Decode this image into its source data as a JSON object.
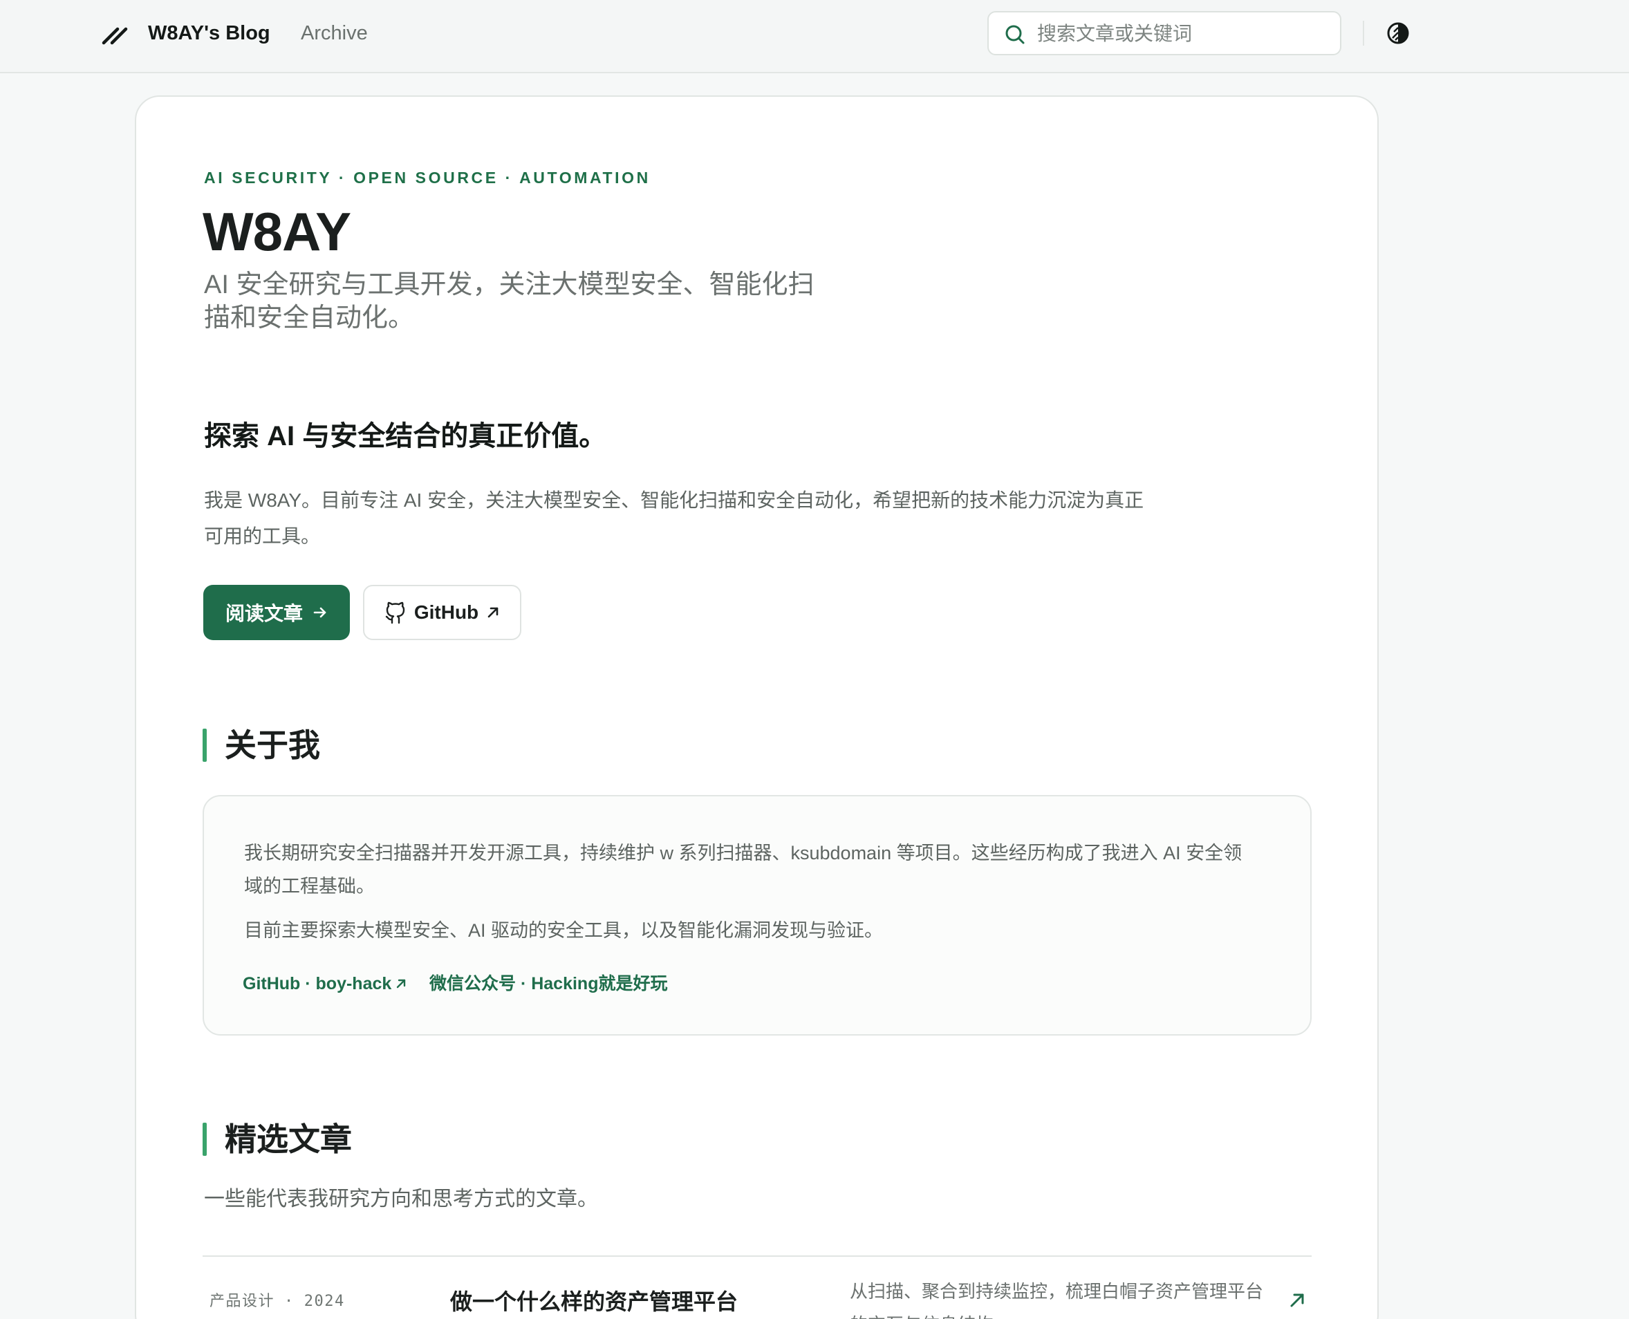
{
  "header": {
    "brand": "W8AY's Blog",
    "nav_archive": "Archive",
    "search_placeholder": "搜索文章或关键词"
  },
  "hero": {
    "eyebrow": "AI SECURITY · OPEN SOURCE · AUTOMATION",
    "title": "W8AY",
    "subtitle": "AI 安全研究与工具开发，关注大模型安全、智能化扫描和安全自动化。",
    "value_heading": "探索 AI 与安全结合的真正价值。",
    "intro": "我是 W8AY。目前专注 AI 安全，关注大模型安全、智能化扫描和安全自动化，希望把新的技术能力沉淀为真正可用的工具。",
    "primary_button": "阅读文章",
    "secondary_button": "GitHub"
  },
  "about": {
    "title": "关于我",
    "paragraph_1": "我长期研究安全扫描器并开发开源工具，持续维护 w 系列扫描器、ksubdomain 等项目。这些经历构成了我进入 AI 安全领域的工程基础。",
    "paragraph_2": "目前主要探索大模型安全、AI 驱动的安全工具，以及智能化漏洞发现与验证。",
    "link_github": "GitHub · boy-hack",
    "link_wechat": "微信公众号 · Hacking就是好玩"
  },
  "featured": {
    "title": "精选文章",
    "description": "一些能代表我研究方向和思考方式的文章。",
    "articles": [
      {
        "category": "产品设计",
        "year": "2024",
        "title": "做一个什么样的资产管理平台",
        "summary": "从扫描、聚合到持续监控，梳理白帽子资产管理平台的交互与信息结构。"
      }
    ]
  },
  "colors": {
    "accent": "#1f6d4b",
    "accent_bar": "#3aa36b",
    "page_bg": "#f6f8f8",
    "card_bg": "#ffffff"
  },
  "icons": {
    "logo": "double-slash-logo-icon",
    "search": "search-icon",
    "theme": "theme-toggle-icon",
    "github": "github-icon",
    "arrow_right": "arrow-right-icon",
    "external": "external-arrow-icon"
  }
}
